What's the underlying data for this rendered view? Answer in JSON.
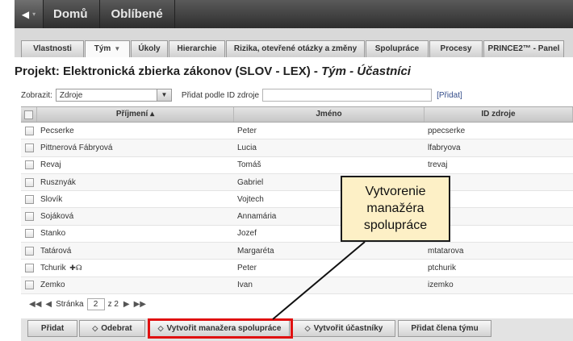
{
  "nav": {
    "back_icon": "back-arrow-icon",
    "items": [
      "Domů",
      "Oblíbené"
    ]
  },
  "tabs": [
    {
      "label": "Vlastnosti",
      "active": false
    },
    {
      "label": "Tým",
      "active": true,
      "has_menu": true
    },
    {
      "label": "Úkoly",
      "active": false
    },
    {
      "label": "Hierarchie",
      "active": false
    },
    {
      "label": "Rizika, otevřené otázky a změny",
      "active": false
    },
    {
      "label": "Spolupráce",
      "active": false
    },
    {
      "label": "Procesy",
      "active": false
    },
    {
      "label": "PRINCE2™ - Panel",
      "active": false
    }
  ],
  "title": {
    "prefix": "Projekt: Elektronická zbierka zákonov (SLOV - LEX) - ",
    "suffix": "Tým - Účastníci"
  },
  "toolbar": {
    "show_label": "Zobrazit:",
    "show_value": "Zdroje",
    "add_by_id_label": "Přidat podle ID zdroje",
    "add_by_id_value": "",
    "add_link": "[Přidat]"
  },
  "table": {
    "columns": {
      "last": "Příjmení ▴",
      "first": "Jméno",
      "id": "ID zdroje"
    },
    "rows": [
      {
        "last": "Pecserke",
        "first": "Peter",
        "id": "ppecserke"
      },
      {
        "last": "Pittnerová Fábryová",
        "first": "Lucia",
        "id": "lfabryova"
      },
      {
        "last": "Revaj",
        "first": "Tomáš",
        "id": "trevaj"
      },
      {
        "last": "Rusznyák",
        "first": "Gabriel",
        "id": ""
      },
      {
        "last": "Slovík",
        "first": "Vojtech",
        "id": ""
      },
      {
        "last": "Sojáková",
        "first": "Annamária",
        "id": ""
      },
      {
        "last": "Stanko",
        "first": "Jozef",
        "id": ""
      },
      {
        "last": "Tatárová",
        "first": "Margaréta",
        "id": "mtatarova"
      },
      {
        "last": "Tchurik",
        "first": "Peter",
        "id": "ptchurik",
        "has_icon": true
      },
      {
        "last": "Zemko",
        "first": "Ivan",
        "id": "izemko"
      }
    ]
  },
  "pager": {
    "page_label": "Stránka",
    "page_value": "2",
    "of_label": "z 2"
  },
  "buttons": {
    "add": "Přidat",
    "remove": "Odebrat",
    "create_manager": "Vytvořit manažera spolupráce",
    "create_participant": "Vytvořit účastníky",
    "add_team_member": "Přidat člena týmu"
  },
  "callout": {
    "text": "Vytvorenie\nmanažéra\nspolupráce"
  },
  "colors": {
    "highlight": "#e01010",
    "callout_bg": "#fdf0c6"
  }
}
